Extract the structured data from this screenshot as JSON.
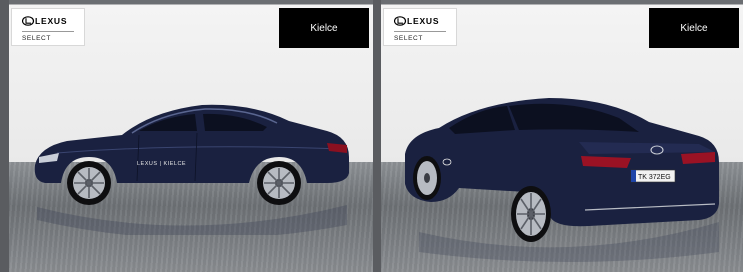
{
  "panels": [
    {
      "brand": "LEXUS",
      "subtitle": "SELECT",
      "dealer": "Kielce",
      "view": "side",
      "car_decal": "LEXUS | KIELCE"
    },
    {
      "brand": "LEXUS",
      "subtitle": "SELECT",
      "dealer": "Kielce",
      "view": "rear-three-quarter",
      "plate": "TK 372EG"
    }
  ],
  "colors": {
    "car_body": "#1a2140",
    "badge": "#000000",
    "floor": "#7a7e82"
  }
}
